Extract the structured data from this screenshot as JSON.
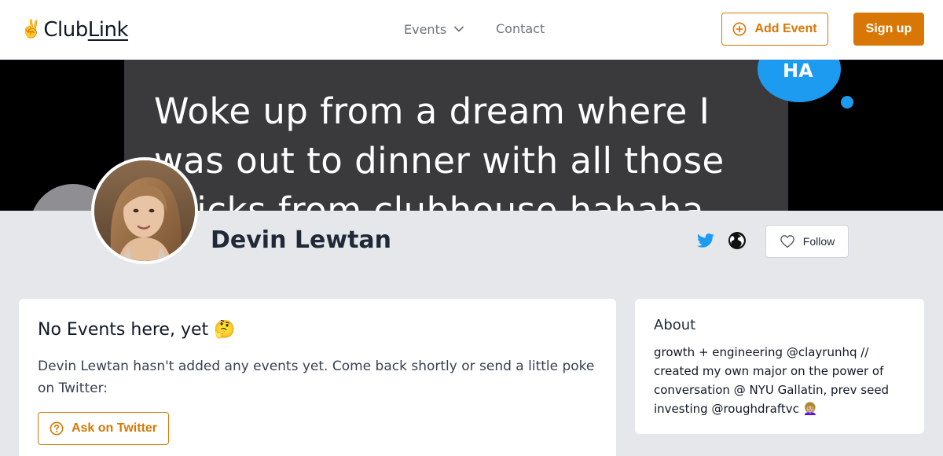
{
  "header": {
    "logo_hand": "✌️",
    "logo_text_main": "Club",
    "logo_text_underlined": "Link",
    "nav": {
      "events_label": "Events",
      "contact_label": "Contact"
    },
    "add_event_label": "Add Event",
    "sign_up_label": "Sign up"
  },
  "banner": {
    "tweet_lines": [
      "Woke up from a dream where I",
      "was out to dinner with all those",
      "chicks from clubhouse hahaha"
    ],
    "ha_text": "HA"
  },
  "profile": {
    "name": "Devin Lewtan",
    "follow_label": "Follow"
  },
  "events_card": {
    "title": "No Events here, yet 🤔",
    "description": "Devin Lewtan hasn't added any events yet. Come back shortly or send a little poke on Twitter:",
    "ask_button_label": "Ask on Twitter"
  },
  "about_card": {
    "title": "About",
    "text": "growth + engineering @clayrunhq // created my own major on the power of conversation @ NYU Gallatin, prev seed investing @roughdraftvc 👩🏼‍🦱"
  },
  "colors": {
    "accent": "#d97706",
    "page_background": "#e5e7eb",
    "twitter_blue": "#1d9bf0"
  },
  "icons": {
    "add": "plus-circle-icon",
    "dropdown": "chevron-down-icon",
    "twitter": "twitter-icon",
    "website": "globe-icon",
    "follow": "heart-icon",
    "ask": "question-circle-icon"
  }
}
